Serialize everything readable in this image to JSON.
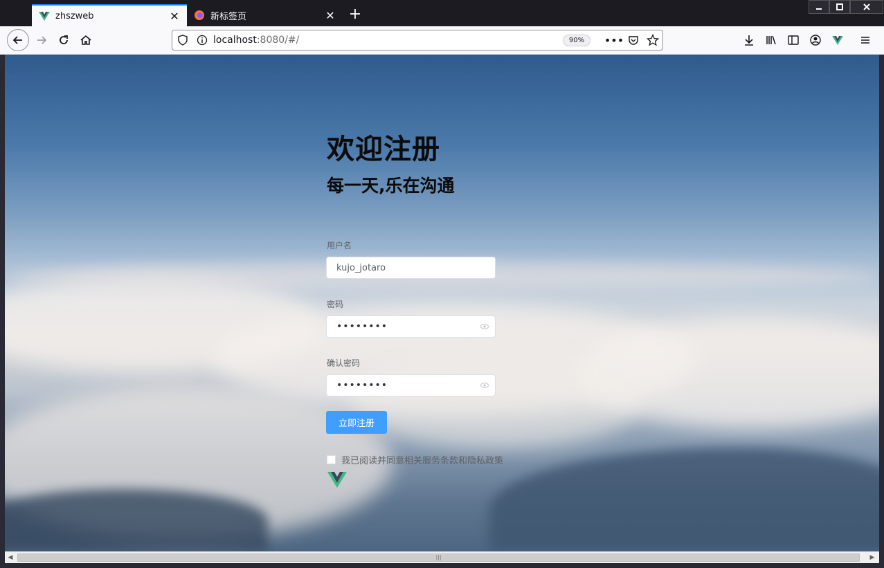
{
  "browser": {
    "tabs": [
      {
        "title": "zhszweb",
        "active": true,
        "icon": "vue-icon"
      },
      {
        "title": "新标签页",
        "active": false,
        "icon": "firefox-icon"
      }
    ],
    "url": {
      "host": "localhost",
      "rest": ":8080/#/"
    },
    "zoom": "90%"
  },
  "page": {
    "title": "欢迎注册",
    "subtitle": "每一天,乐在沟通",
    "username": {
      "label": "用户名",
      "value": "kujo_jotaro"
    },
    "password": {
      "label": "密码",
      "value": "••••••••"
    },
    "confirm_password": {
      "label": "确认密码",
      "value": "••••••••"
    },
    "submit_label": "立即注册",
    "agreement": "我已阅读并同意相关服务条款和隐私政策"
  },
  "colors": {
    "primary_button": "#409eff",
    "tab_accent": "#0a84ff",
    "vue_green": "#41b883",
    "vue_dark": "#35495e"
  }
}
